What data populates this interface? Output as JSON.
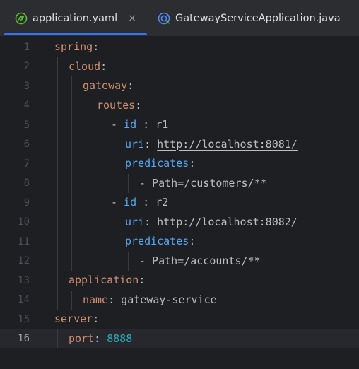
{
  "tabs": [
    {
      "label": "application.yaml",
      "icon": "spring-leaf-icon",
      "active": true,
      "close": "×"
    },
    {
      "label": "GatewayServiceApplication.java",
      "icon": "spring-boot-app-icon",
      "active": false
    }
  ],
  "colors": {
    "key": "#cf8e6d",
    "key_blue": "#56a8f5",
    "number": "#2aacb8",
    "text": "#bcbec4",
    "accent": "#3574f0"
  },
  "current_line": 16,
  "lines": [
    {
      "n": "1",
      "indent": 0,
      "parts": [
        {
          "t": "spring",
          "c": "k"
        },
        {
          "t": ":",
          "c": ""
        }
      ]
    },
    {
      "n": "2",
      "indent": 1,
      "parts": [
        {
          "t": "cloud",
          "c": "k"
        },
        {
          "t": ":",
          "c": ""
        }
      ]
    },
    {
      "n": "3",
      "indent": 2,
      "parts": [
        {
          "t": "gateway",
          "c": "k"
        },
        {
          "t": ":",
          "c": ""
        }
      ]
    },
    {
      "n": "4",
      "indent": 3,
      "parts": [
        {
          "t": "routes",
          "c": "k"
        },
        {
          "t": ":",
          "c": ""
        }
      ]
    },
    {
      "n": "5",
      "indent": 4,
      "parts": [
        {
          "t": "- ",
          "c": ""
        },
        {
          "t": "id",
          "c": "kb"
        },
        {
          "t": " : r1",
          "c": ""
        }
      ]
    },
    {
      "n": "6",
      "indent": 5,
      "parts": [
        {
          "t": "uri",
          "c": "kb"
        },
        {
          "t": ": ",
          "c": ""
        },
        {
          "t": "http://localhost:8081/",
          "c": "link"
        }
      ]
    },
    {
      "n": "7",
      "indent": 5,
      "parts": [
        {
          "t": "predicates",
          "c": "kb"
        },
        {
          "t": ":",
          "c": ""
        }
      ]
    },
    {
      "n": "8",
      "indent": 6,
      "parts": [
        {
          "t": "- Path=/customers/**",
          "c": ""
        }
      ]
    },
    {
      "n": "9",
      "indent": 4,
      "parts": [
        {
          "t": "- ",
          "c": ""
        },
        {
          "t": "id",
          "c": "kb"
        },
        {
          "t": " : r2",
          "c": ""
        }
      ]
    },
    {
      "n": "10",
      "indent": 5,
      "parts": [
        {
          "t": "uri",
          "c": "kb"
        },
        {
          "t": ": ",
          "c": ""
        },
        {
          "t": "http://localhost:8082/",
          "c": "link"
        }
      ]
    },
    {
      "n": "11",
      "indent": 5,
      "parts": [
        {
          "t": "predicates",
          "c": "kb"
        },
        {
          "t": ":",
          "c": ""
        }
      ]
    },
    {
      "n": "12",
      "indent": 6,
      "parts": [
        {
          "t": "- Path=/accounts/**",
          "c": ""
        }
      ]
    },
    {
      "n": "13",
      "indent": 1,
      "parts": [
        {
          "t": "application",
          "c": "k"
        },
        {
          "t": ":",
          "c": ""
        }
      ]
    },
    {
      "n": "14",
      "indent": 2,
      "parts": [
        {
          "t": "name",
          "c": "k"
        },
        {
          "t": ": gateway-service",
          "c": ""
        }
      ]
    },
    {
      "n": "15",
      "indent": 0,
      "parts": [
        {
          "t": "server",
          "c": "k"
        },
        {
          "t": ":",
          "c": ""
        }
      ]
    },
    {
      "n": "16",
      "indent": 1,
      "parts": [
        {
          "t": "port",
          "c": "k"
        },
        {
          "t": ": ",
          "c": ""
        },
        {
          "t": "8888",
          "c": "num"
        }
      ]
    }
  ]
}
